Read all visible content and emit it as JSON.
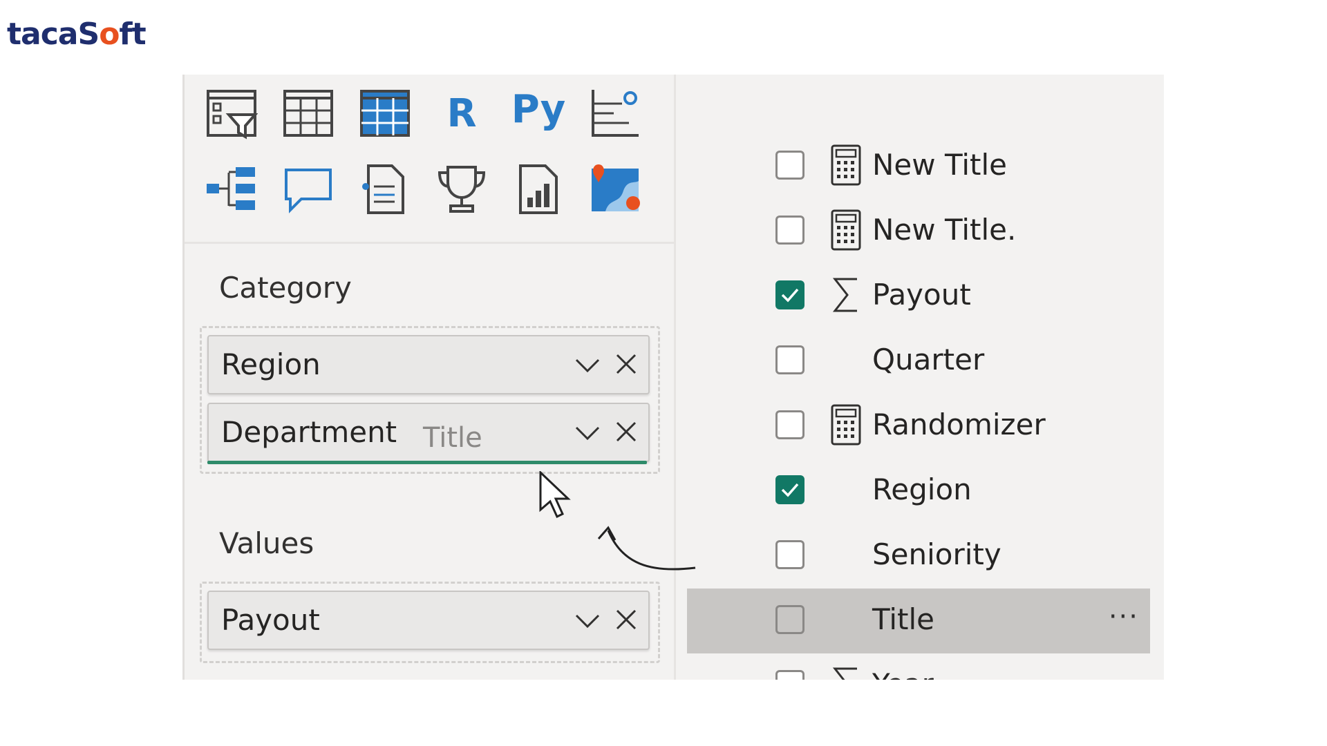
{
  "brand": {
    "logo_prefix": "tacaS",
    "logo_o": "o",
    "logo_suffix": "ft"
  },
  "visuals": {
    "icons": [
      "slicer-icon",
      "table-icon",
      "matrix-icon",
      "r-visual-icon",
      "python-visual-icon",
      "key-influencers-icon",
      "decomposition-tree-icon",
      "qa-icon",
      "smart-narrative-icon",
      "goals-icon",
      "paginated-report-icon",
      "azure-map-icon"
    ],
    "r_label": "R",
    "py_label": "Py"
  },
  "wells": {
    "category": {
      "title": "Category",
      "fields": [
        "Region",
        "Department"
      ],
      "drag_ghost": "Title"
    },
    "values": {
      "title": "Values",
      "fields": [
        "Payout"
      ]
    }
  },
  "field_list": {
    "items": [
      {
        "name": "New Title",
        "checked": false,
        "icon": "calculator-icon"
      },
      {
        "name": "New Title.",
        "checked": false,
        "icon": "calculator-icon"
      },
      {
        "name": "Payout",
        "checked": true,
        "icon": "sigma-icon"
      },
      {
        "name": "Quarter",
        "checked": false,
        "icon": ""
      },
      {
        "name": "Randomizer",
        "checked": false,
        "icon": "calculator-icon"
      },
      {
        "name": "Region",
        "checked": true,
        "icon": ""
      },
      {
        "name": "Seniority",
        "checked": false,
        "icon": ""
      },
      {
        "name": "Title",
        "checked": false,
        "icon": "",
        "highlighted": true,
        "more": "···"
      },
      {
        "name": "Year",
        "checked": false,
        "icon": "sigma-icon"
      }
    ]
  },
  "colors": {
    "accent": "#117865",
    "visual_blue": "#2a7cc7",
    "highlight": "#c8c6c4",
    "brand_navy": "#1f2e6e",
    "brand_orange": "#e8501f"
  }
}
